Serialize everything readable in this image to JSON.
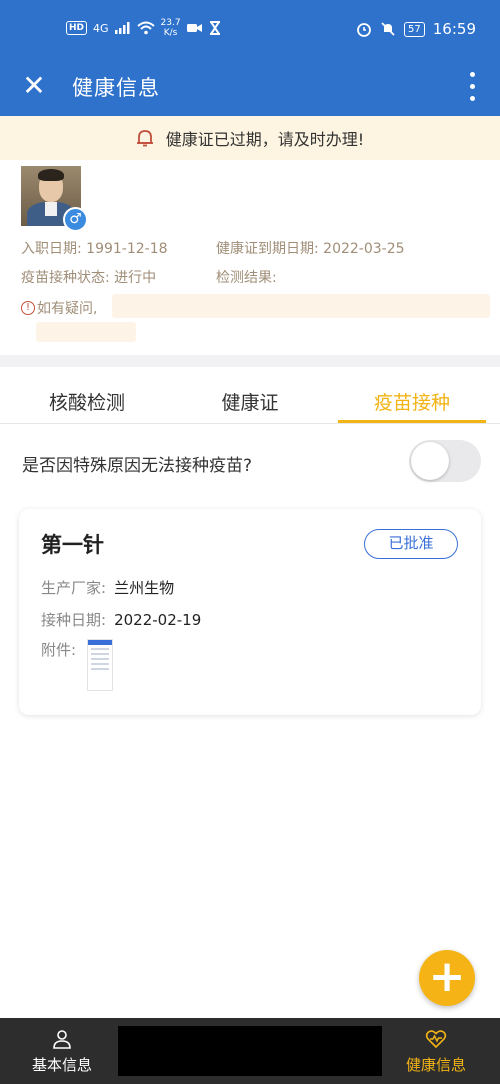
{
  "status_bar": {
    "network": "4G",
    "speed": "23.7",
    "speed_unit": "K/s",
    "battery": "57",
    "time": "16:59"
  },
  "app_bar": {
    "title": "健康信息"
  },
  "banner": {
    "text": "健康证已过期，请及时办理!"
  },
  "profile": {
    "entry_date_label": "入职日期:",
    "entry_date": "1991-12-18",
    "cert_expiry_label": "健康证到期日期:",
    "cert_expiry": "2022-03-25",
    "vaccine_status_label": "疫苗接种状态:",
    "vaccine_status": "进行中",
    "test_result_label": "检测结果:",
    "test_result": "",
    "question_text": "如有疑问,"
  },
  "tabs": [
    {
      "label": "核酸检测"
    },
    {
      "label": "健康证"
    },
    {
      "label": "疫苗接种"
    }
  ],
  "active_tab": "疫苗接种",
  "toggle_row": {
    "label": "是否因特殊原因无法接种疫苗?",
    "value": false
  },
  "vaccine_record": {
    "title": "第一针",
    "status": "已批准",
    "manufacturer_label": "生产厂家:",
    "manufacturer": "兰州生物",
    "date_label": "接种日期:",
    "date": "2022-02-19",
    "attachment_label": "附件:"
  },
  "bottom_nav": {
    "left_label": "基本信息",
    "right_label": "健康信息"
  },
  "colors": {
    "primary": "#2f72cc",
    "accent": "#f2b315",
    "badge": "#3a6fd8"
  }
}
